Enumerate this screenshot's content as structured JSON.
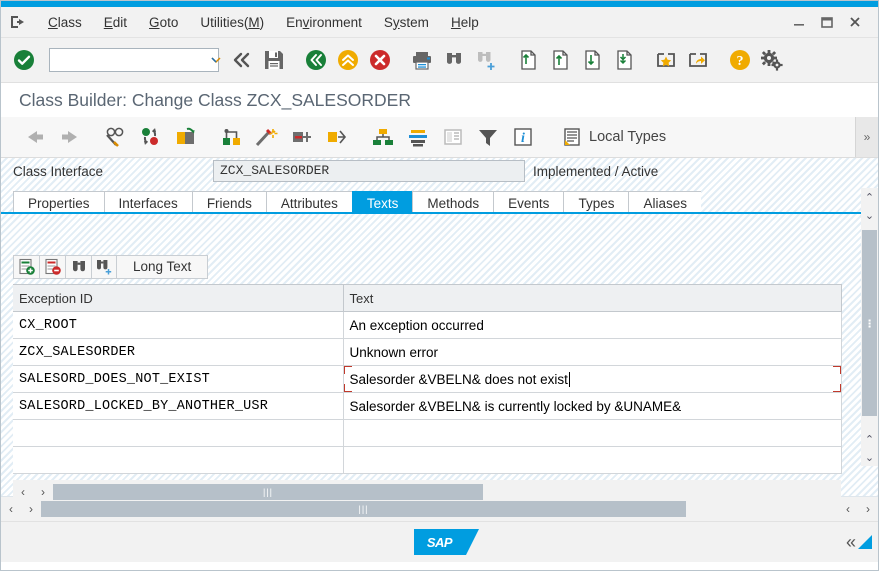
{
  "window": {
    "minimize": "—",
    "maximize": "▢",
    "close": "✕"
  },
  "menu": {
    "items": [
      {
        "pre": "",
        "acc": "C",
        "post": "lass"
      },
      {
        "pre": "",
        "acc": "E",
        "post": "dit"
      },
      {
        "pre": "",
        "acc": "G",
        "post": "oto"
      },
      {
        "pre": "Utilities(",
        "acc": "M",
        "post": ")"
      },
      {
        "pre": "En",
        "acc": "v",
        "post": "ironment"
      },
      {
        "pre": "S",
        "acc": "y",
        "post": "stem"
      },
      {
        "pre": "",
        "acc": "H",
        "post": "elp"
      }
    ]
  },
  "systoolbar": {
    "command_value": "",
    "command_placeholder": "",
    "icons": [
      "enter-check-icon",
      "back-double-icon",
      "save-icon",
      "back-green-icon",
      "up-orange-icon",
      "cancel-red-icon",
      "print-icon",
      "find-icon",
      "find-next-icon",
      "first-page-icon",
      "previous-page-icon",
      "next-page-icon",
      "last-page-icon",
      "create-shortcut-icon",
      "customize-local-layout-icon",
      "help-icon",
      "settings-gear-icon"
    ]
  },
  "page": {
    "title": "Class Builder: Change Class ZCX_SALESORDER"
  },
  "apptoolbar": {
    "local_types_label": "Local Types",
    "overflow_label": "»",
    "icons": [
      "back-arrow-icon",
      "forward-arrow-icon",
      "display-change-icon",
      "activate-icon",
      "copy-object-icon",
      "class-hierarchy-icon",
      "pattern-wizard-icon",
      "signature-icon",
      "refactor-icon",
      "inheritance-icon",
      "structure-icon",
      "print-preview-icon",
      "filter-icon",
      "info-icon",
      "local-types-icon"
    ]
  },
  "classinfo": {
    "label": "Class Interface",
    "name_value": "ZCX_SALESORDER",
    "status": "Implemented / Active"
  },
  "tabs": [
    {
      "label": "Properties",
      "active": false
    },
    {
      "label": "Interfaces",
      "active": false
    },
    {
      "label": "Friends",
      "active": false
    },
    {
      "label": "Attributes",
      "active": false
    },
    {
      "label": "Texts",
      "active": true
    },
    {
      "label": "Methods",
      "active": false
    },
    {
      "label": "Events",
      "active": false
    },
    {
      "label": "Types",
      "active": false
    },
    {
      "label": "Aliases",
      "active": false
    }
  ],
  "gridtoolbar": {
    "insert_row_label": "insert-row-icon",
    "delete_row_label": "delete-row-icon",
    "find_label": "find-icon",
    "find_next_label": "find-next-icon",
    "long_text_label": "Long Text"
  },
  "table": {
    "headers": [
      "Exception ID",
      "Text"
    ],
    "rows": [
      {
        "id": "CX_ROOT",
        "text": "An exception occurred",
        "selected": false
      },
      {
        "id": "ZCX_SALESORDER",
        "text": "Unknown error",
        "selected": false
      },
      {
        "id": "SALESORD_DOES_NOT_EXIST",
        "text": "Salesorder &VBELN& does not exist",
        "selected": true
      },
      {
        "id": "SALESORD_LOCKED_BY_ANOTHER_USR",
        "text": "Salesorder &VBELN& is currently locked by &UNAME&",
        "selected": false
      },
      {
        "id": "",
        "text": "",
        "selected": false
      },
      {
        "id": "",
        "text": "",
        "selected": false
      }
    ]
  },
  "scrollbars": {
    "left_arrow": "‹",
    "right_arrow": "›",
    "up_arrow": "⌃",
    "down_arrow": "⌄",
    "grip": "|||"
  },
  "footer": {
    "logo_text": "SAP",
    "collapse_label": "«"
  },
  "colors": {
    "accent": "#009de0",
    "selection": "#e8f2fa",
    "marker": "#c0392b",
    "green": "#198039",
    "orange": "#f0ab00",
    "red": "#cc2b2b"
  }
}
